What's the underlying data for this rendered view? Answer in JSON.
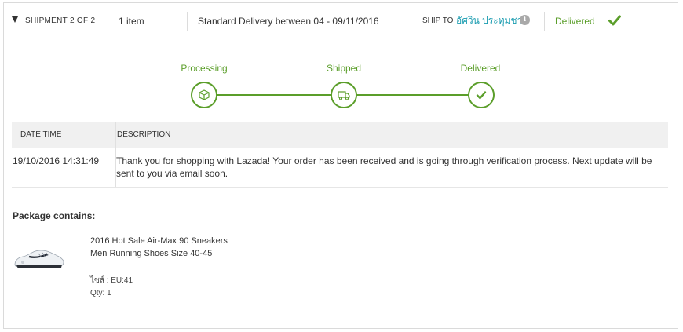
{
  "shipment": {
    "title": "SHIPMENT 2 OF 2",
    "items": "1 item",
    "delivery": "Standard Delivery between 04 - 09/11/2016",
    "ship_to_label": "SHIP TO",
    "ship_to_name": "อัศวิน ประทุมชา",
    "status": "Delivered"
  },
  "progress": {
    "steps": [
      {
        "label": "Processing",
        "icon": "box-icon"
      },
      {
        "label": "Shipped",
        "icon": "truck-icon"
      },
      {
        "label": "Delivered",
        "icon": "check-icon"
      }
    ]
  },
  "history": {
    "columns": [
      "DATE TIME",
      "DESCRIPTION"
    ],
    "rows": [
      {
        "datetime": "19/10/2016 14:31:49",
        "description": "Thank you for shopping with Lazada! Your order has been received and is going through verification process. Next update will be sent to you via email soon."
      }
    ]
  },
  "package": {
    "title": "Package contains:",
    "product": {
      "name": "2016 Hot Sale Air-Max 90 Sneakers Men Running Shoes Size 40-45",
      "size": "ไซส์ : EU:41",
      "qty": "Qty: 1"
    }
  },
  "colors": {
    "accent_green": "#5b9e2a",
    "link_teal": "#1a9cb0"
  }
}
